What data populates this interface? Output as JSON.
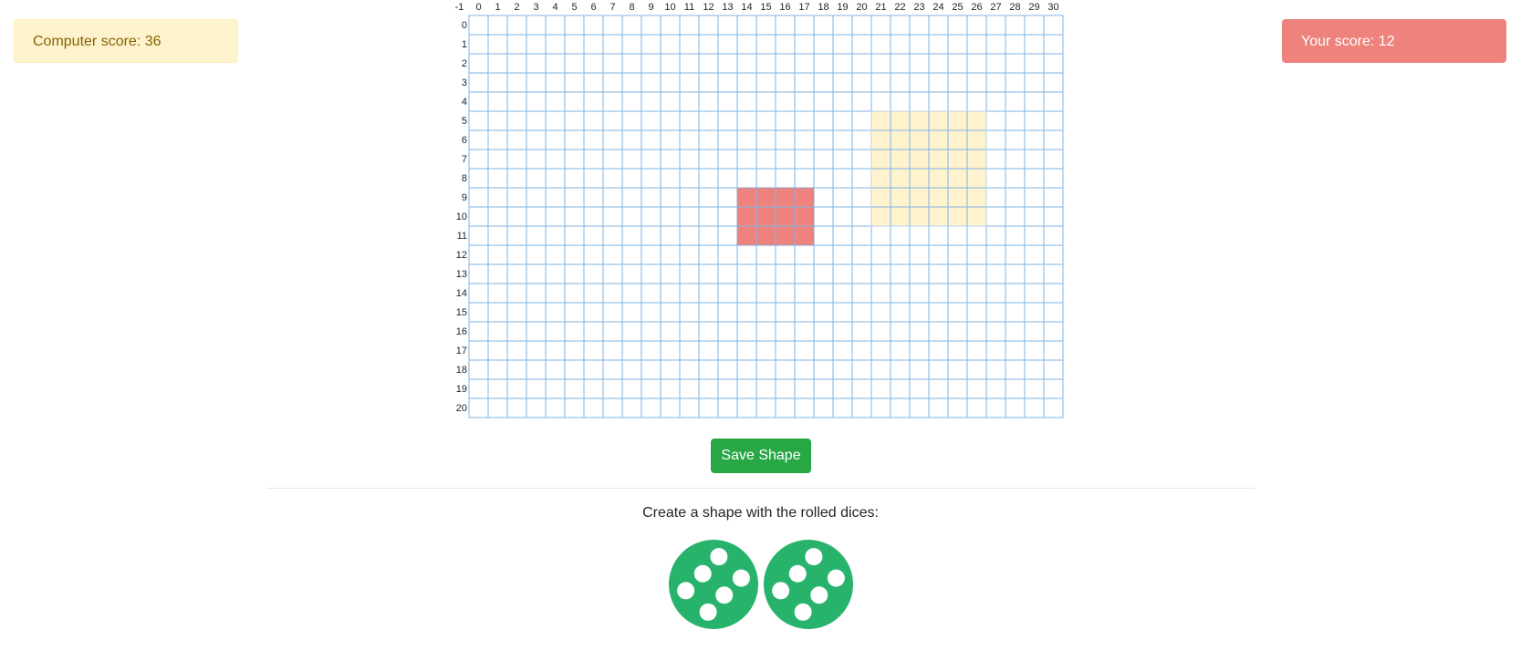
{
  "scores": {
    "computer_label": "Computer score: 36",
    "player_label": "Your score: 12"
  },
  "board": {
    "columns": [
      -1,
      0,
      1,
      2,
      3,
      4,
      5,
      6,
      7,
      8,
      9,
      10,
      11,
      12,
      13,
      14,
      15,
      16,
      17,
      18,
      19,
      20,
      21,
      22,
      23,
      24,
      25,
      26,
      27,
      28,
      29,
      30
    ],
    "rows": [
      0,
      1,
      2,
      3,
      4,
      5,
      6,
      7,
      8,
      9,
      10,
      11,
      12,
      13,
      14,
      15,
      16,
      17,
      18,
      19,
      20
    ],
    "grid_color": "#7eb6e6",
    "shapes": [
      {
        "owner": "computer",
        "col": 21,
        "row": 5,
        "width": 6,
        "height": 6,
        "color": "#fff3cd"
      },
      {
        "owner": "player",
        "col": 14,
        "row": 9,
        "width": 4,
        "height": 3,
        "color": "#ee827c"
      }
    ]
  },
  "actions": {
    "save_label": "Save Shape"
  },
  "dice_section": {
    "prompt": "Create a shape with the rolled dices:",
    "dice": [
      {
        "value": 6,
        "color": "#27b36c"
      },
      {
        "value": 6,
        "color": "#27b36c"
      }
    ]
  }
}
